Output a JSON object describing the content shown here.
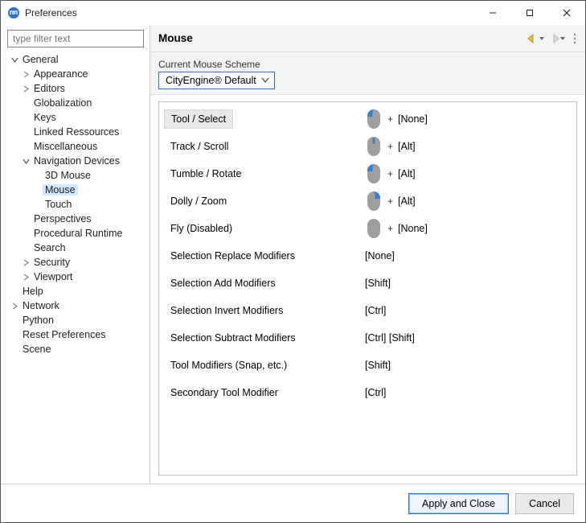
{
  "window": {
    "title": "Preferences"
  },
  "filter": {
    "placeholder": "type filter text"
  },
  "tree": [
    {
      "label": "General",
      "indent": 0,
      "arrow": "down"
    },
    {
      "label": "Appearance",
      "indent": 1,
      "arrow": "right"
    },
    {
      "label": "Editors",
      "indent": 1,
      "arrow": "right"
    },
    {
      "label": "Globalization",
      "indent": 1
    },
    {
      "label": "Keys",
      "indent": 1
    },
    {
      "label": "Linked Ressources",
      "indent": 1
    },
    {
      "label": "Miscellaneous",
      "indent": 1
    },
    {
      "label": "Navigation Devices",
      "indent": 1,
      "arrow": "down"
    },
    {
      "label": "3D Mouse",
      "indent": 2
    },
    {
      "label": "Mouse",
      "indent": 2,
      "selected": true
    },
    {
      "label": "Touch",
      "indent": 2
    },
    {
      "label": "Perspectives",
      "indent": 1
    },
    {
      "label": "Procedural Runtime",
      "indent": 1
    },
    {
      "label": "Search",
      "indent": 1
    },
    {
      "label": "Security",
      "indent": 1,
      "arrow": "right"
    },
    {
      "label": "Viewport",
      "indent": 1,
      "arrow": "right"
    },
    {
      "label": "Help",
      "indent": 0
    },
    {
      "label": "Network",
      "indent": 0,
      "arrow": "right"
    },
    {
      "label": "Python",
      "indent": 0
    },
    {
      "label": "Reset Preferences",
      "indent": 0
    },
    {
      "label": "Scene",
      "indent": 0
    }
  ],
  "page": {
    "heading": "Mouse",
    "scheme_label": "Current Mouse Scheme",
    "scheme_value": "CityEngine® Default"
  },
  "bindings": [
    {
      "action": "Tool / Select",
      "mouse": "left",
      "mod": "[None]",
      "selected": true
    },
    {
      "action": "Track / Scroll",
      "mouse": "middle",
      "mod": "[Alt]"
    },
    {
      "action": "Tumble / Rotate",
      "mouse": "left",
      "mod": "[Alt]"
    },
    {
      "action": "Dolly / Zoom",
      "mouse": "right",
      "mod": "[Alt]"
    },
    {
      "action": "Fly (Disabled)",
      "mouse": "none",
      "mod": "[None]"
    },
    {
      "action": "Selection Replace Modifiers",
      "value": "[None]"
    },
    {
      "action": "Selection Add Modifiers",
      "value": "[Shift]"
    },
    {
      "action": "Selection Invert Modifiers",
      "value": "[Ctrl]"
    },
    {
      "action": "Selection Subtract Modifiers",
      "value": "[Ctrl] [Shift]"
    },
    {
      "action": "Tool Modifiers (Snap, etc.)",
      "value": "[Shift]"
    },
    {
      "action": "Secondary Tool Modifier",
      "value": "[Ctrl]"
    }
  ],
  "buttons": {
    "apply": "Apply and Close",
    "cancel": "Cancel"
  },
  "colors": {
    "accent": "#2a72ce",
    "mouse_active": "#3b7fd1",
    "mouse_body": "#9e9e9e"
  }
}
